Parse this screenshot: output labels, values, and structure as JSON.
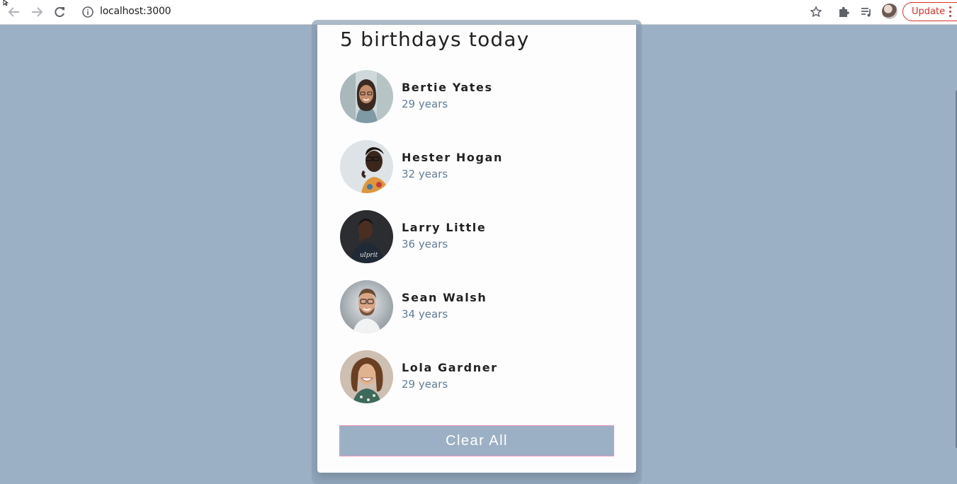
{
  "browser": {
    "url": "localhost:3000",
    "update_label": "Update",
    "icons": [
      "back-icon",
      "forward-icon",
      "reload-icon",
      "info-icon",
      "star-icon",
      "extensions-icon",
      "media-icon",
      "profile-avatar",
      "more-icon"
    ]
  },
  "card": {
    "title": "5 birthdays today",
    "people": [
      {
        "name": "Bertie Yates",
        "age": "29 years",
        "avatar": "woman-glasses-city"
      },
      {
        "name": "Hester Hogan",
        "age": "32 years",
        "avatar": "woman-glasses-floral"
      },
      {
        "name": "Larry Little",
        "age": "36 years",
        "avatar": "man-dark-shirt"
      },
      {
        "name": "Sean Walsh",
        "age": "34 years",
        "avatar": "man-glasses-beard"
      },
      {
        "name": "Lola Gardner",
        "age": "29 years",
        "avatar": "woman-curly-hair"
      }
    ],
    "clear_label": "Clear All"
  },
  "colors": {
    "background": "#9cb0c5",
    "card": "#fdfdfd",
    "age_text": "#617d98",
    "button": "#9cb0c5",
    "button_border": "#ef8fb8",
    "update": "#d93025"
  }
}
